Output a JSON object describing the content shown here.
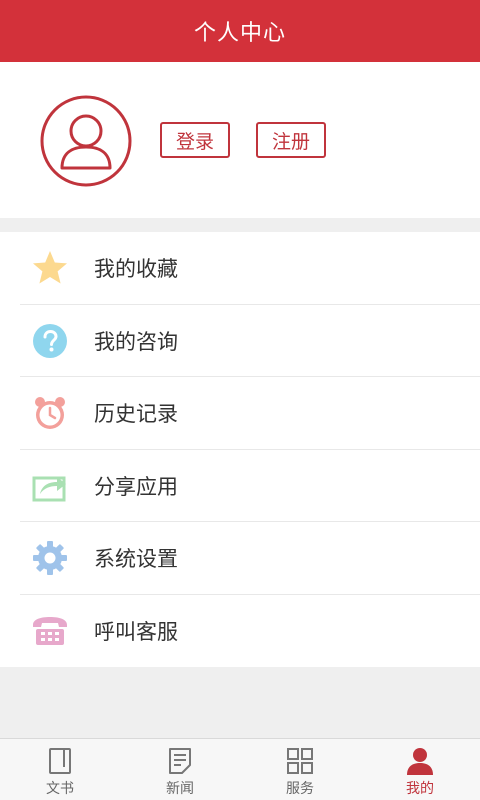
{
  "header": {
    "title": "个人中心"
  },
  "profile": {
    "login_label": "登录",
    "register_label": "注册"
  },
  "menu": {
    "items": [
      {
        "label": "我的收藏",
        "icon": "star-icon",
        "color": "#fcd98f"
      },
      {
        "label": "我的咨询",
        "icon": "question-icon",
        "color": "#8fd6ee"
      },
      {
        "label": "历史记录",
        "icon": "alarm-clock-icon",
        "color": "#f3a09b"
      },
      {
        "label": "分享应用",
        "icon": "share-icon",
        "color": "#a9e0b2"
      },
      {
        "label": "系统设置",
        "icon": "gear-icon",
        "color": "#9fc3ea"
      },
      {
        "label": "呼叫客服",
        "icon": "telephone-icon",
        "color": "#e7a8cb"
      }
    ]
  },
  "tabbar": {
    "tabs": [
      {
        "label": "文书",
        "icon": "book-icon"
      },
      {
        "label": "新闻",
        "icon": "news-icon"
      },
      {
        "label": "服务",
        "icon": "grid-icon"
      },
      {
        "label": "我的",
        "icon": "user-icon",
        "active": true
      }
    ],
    "active_color": "#c0343c"
  },
  "colors": {
    "header_bg": "#d3313a",
    "accent": "#c0343c"
  }
}
